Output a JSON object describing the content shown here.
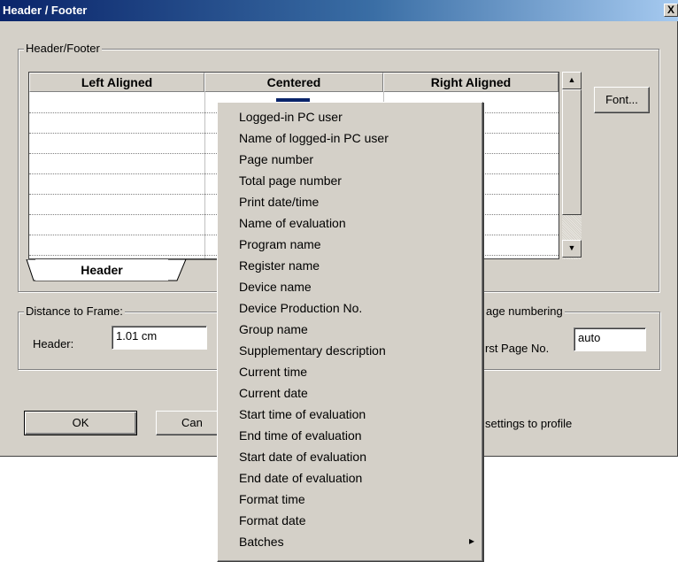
{
  "window": {
    "title": "Header / Footer",
    "close_label": "X"
  },
  "header_footer_group": {
    "label": "Header/Footer"
  },
  "table": {
    "columns": [
      "Left Aligned",
      "Centered",
      "Right Aligned"
    ],
    "visible_rows": 8
  },
  "font_button": "Font...",
  "tabs": {
    "header": "Header"
  },
  "distance_group": {
    "label": "Distance to Frame:",
    "header_label": "Header:",
    "header_value": "1.01 cm"
  },
  "page_numbering_group": {
    "label": "age numbering",
    "first_page_label": "rst Page No.",
    "first_page_value": "auto"
  },
  "buttons": {
    "ok": "OK",
    "cancel": "Can",
    "save_profile": "settings to profile"
  },
  "context_menu": {
    "items": [
      "Logged-in PC user",
      "Name of logged-in PC user",
      "Page number",
      "Total page number",
      "Print date/time",
      "Name of evaluation",
      "Program name",
      "Register name",
      "Device name",
      "Device Production No.",
      "Group name",
      "Supplementary description",
      "Current time",
      "Current date",
      "Start time of evaluation",
      "End time of evaluation",
      "Start date of evaluation",
      "End date of evaluation",
      "Format time",
      "Format date",
      "Batches"
    ],
    "submenu_arrow": "▸"
  }
}
